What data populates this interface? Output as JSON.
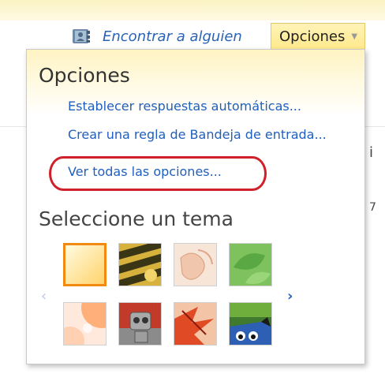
{
  "header": {
    "find_person_label": "Encontrar a alguien",
    "options_tab_label": "Opciones"
  },
  "dropdown": {
    "title": "Opciones",
    "links": [
      "Establecer respuestas automáticas...",
      "Crear una regla de Bandeja de entrada...",
      "Ver todas las opciones..."
    ],
    "theme_heading": "Seleccione un tema",
    "themes": [
      {
        "name": "sun",
        "colors": [
          "#fff3c0",
          "#ffd77a"
        ],
        "selected": true
      },
      {
        "name": "tiger",
        "colors": [
          "#d9b640",
          "#3c3c1a"
        ]
      },
      {
        "name": "sketch",
        "colors": [
          "#f8e3d6",
          "#e8b9a0"
        ]
      },
      {
        "name": "leaves-green",
        "colors": [
          "#8ccb6a",
          "#4b9b3a"
        ]
      },
      {
        "name": "bubbles",
        "colors": [
          "#ffd2b8",
          "#ffa46a"
        ]
      },
      {
        "name": "robot",
        "colors": [
          "#9e9e9e",
          "#c93a2a"
        ]
      },
      {
        "name": "autumn-leaves",
        "colors": [
          "#e8552f",
          "#b52416"
        ]
      },
      {
        "name": "monster",
        "colors": [
          "#3b6e2c",
          "#1a1a1a"
        ]
      }
    ]
  },
  "colors": {
    "link": "#1f5fbf",
    "highlight": "#d0202a",
    "selection": "#f28a12"
  },
  "page": {
    "right_edge_glyphs": [
      "i",
      "7"
    ]
  }
}
